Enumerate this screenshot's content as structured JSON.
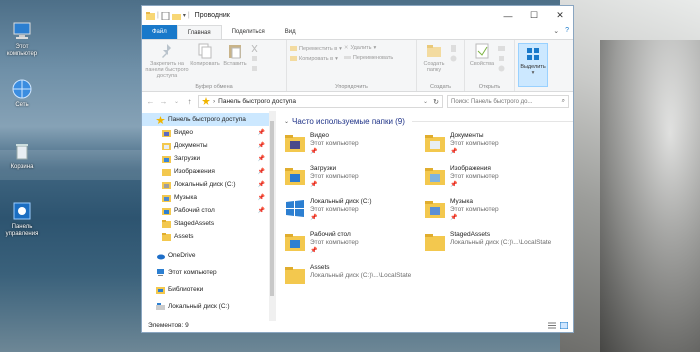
{
  "desktop": {
    "icons": [
      {
        "label": "Этот компьютер",
        "icon": "computer-icon"
      },
      {
        "label": "Сеть",
        "icon": "network-icon"
      },
      {
        "label": "Корзина",
        "icon": "recycle-bin-icon"
      },
      {
        "label": "Панель управления",
        "icon": "control-panel-icon"
      }
    ]
  },
  "window": {
    "title": "Проводник",
    "controls": {
      "minimize": "—",
      "maximize": "☐",
      "close": "✕"
    }
  },
  "tabs": {
    "items": [
      "Файл",
      "Главная",
      "Поделиться",
      "Вид"
    ],
    "help": "?"
  },
  "ribbon": {
    "clipboard": {
      "pin": "Закрепить на панели быстрого доступа",
      "copy": "Копировать",
      "paste": "Вставить",
      "label": "Буфер обмена"
    },
    "organize": {
      "move": "Переместить в",
      "copy_to": "Копировать в",
      "delete": "Удалить",
      "rename": "Переименовать",
      "label": "Упорядочить"
    },
    "create": {
      "new_folder": "Создать папку",
      "label": "Создать"
    },
    "open": {
      "properties": "Свойства",
      "label": "Открыть"
    },
    "select": {
      "select": "Выделить"
    }
  },
  "address": {
    "path": "Панель быстрого доступа",
    "search_placeholder": "Поиск: Панель быстрого до..."
  },
  "nav": {
    "quick_access": "Панель быстрого доступа",
    "pinned": [
      "Видео",
      "Документы",
      "Загрузки",
      "Изображения",
      "Локальный диск (C:)",
      "Музыка",
      "Рабочий стол"
    ],
    "recent": [
      "StagedAssets",
      "Assets"
    ],
    "onedrive": "OneDrive",
    "this_pc": "Этот компьютер",
    "libraries": "Библиотеки",
    "local_disk": "Локальный диск (C:)"
  },
  "content": {
    "section_title": "Часто используемые папки (9)",
    "tiles": [
      {
        "name": "Видео",
        "sub": "Этот компьютер",
        "pinned": true
      },
      {
        "name": "Документы",
        "sub": "Этот компьютер",
        "pinned": true
      },
      {
        "name": "Загрузки",
        "sub": "Этот компьютер",
        "pinned": true
      },
      {
        "name": "Изображения",
        "sub": "Этот компьютер",
        "pinned": true
      },
      {
        "name": "Локальный диск (C:)",
        "sub": "Этот компьютер",
        "pinned": true
      },
      {
        "name": "Музыка",
        "sub": "Этот компьютер",
        "pinned": true
      },
      {
        "name": "Рабочий стол",
        "sub": "Этот компьютер",
        "pinned": true
      },
      {
        "name": "StagedAssets",
        "sub": "Локальный диск (C:)\\...\\LocalState",
        "pinned": false
      },
      {
        "name": "Assets",
        "sub": "Локальный диск (C:)\\...\\LocalState",
        "pinned": false
      }
    ]
  },
  "status": {
    "items": "Элементов: 9"
  }
}
